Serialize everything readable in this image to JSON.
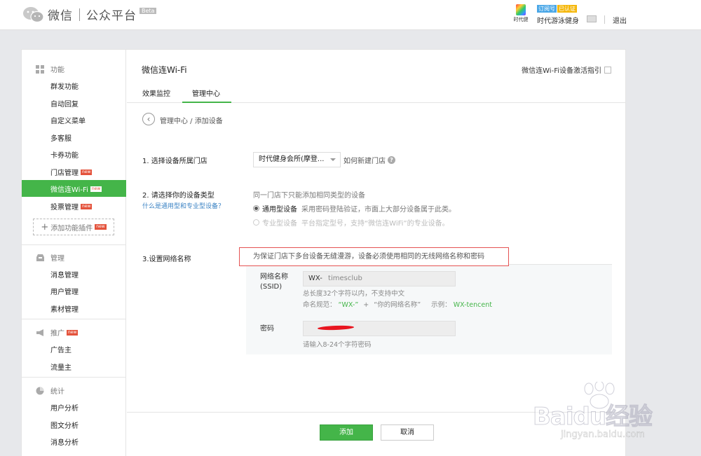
{
  "header": {
    "app_name": "微信",
    "platform": "公众平台",
    "beta": "Beta",
    "account_caption": "时代健",
    "badge_subscription": "订阅号",
    "badge_verified": "已认证",
    "account_name": "时代游泳健身",
    "logout": "退出"
  },
  "sidebar": {
    "sections": {
      "features": "功能",
      "management": "管理",
      "promotion": "推广",
      "statistics": "统计"
    },
    "new_badge": "new",
    "features_items": [
      "群发功能",
      "自动回复",
      "自定义菜单",
      "多客服",
      "卡券功能",
      "门店管理"
    ],
    "active_item": "微信连Wi-Fi",
    "vote_item": "投票管理",
    "add_plugin": "添加功能插件",
    "management_items": [
      "消息管理",
      "用户管理",
      "素材管理"
    ],
    "promotion_items": [
      "广告主",
      "流量主"
    ],
    "statistics_items": [
      "用户分析",
      "图文分析",
      "消息分析"
    ]
  },
  "main": {
    "title": "微信连Wi-Fi",
    "guide_link": "微信连Wi-Fi设备激活指引",
    "tabs": [
      "效果监控",
      "管理中心"
    ],
    "active_tab": "管理中心",
    "breadcrumb": "管理中心 / 添加设备",
    "step1": {
      "label": "1. 选择设备所属门店",
      "selected": "时代健身会所(摩登...",
      "howto": "如何新建门店"
    },
    "step2": {
      "label": "2. 请选择你的设备类型",
      "help_link": "什么是通用型和专业型设备？",
      "hint": "同一门店下只能添加相同类型的设备",
      "option1_name": "通用型设备",
      "option1_desc": "采用密码登陆验证，市面上大部分设备属于此类。",
      "option2_name": "专业型设备",
      "option2_desc": "平台指定型号，支持“微信连WiFi”的专业设备。"
    },
    "step3": {
      "label": "3.设置网络名称",
      "warning": "为保证门店下多台设备无缝漫游，设备必须使用相同的无线网络名称和密码",
      "ssid_label_1": "网络名称",
      "ssid_label_2": "(SSID)",
      "ssid_prefix": "WX-",
      "ssid_value": "timesclub",
      "ssid_note1": "总长度32个字符以内，不支持中文",
      "ssid_rule_prefix": "命名规范：",
      "ssid_rule_wx": "“WX-”",
      "ssid_rule_plus": "+",
      "ssid_rule_name": "“你的网络名称”",
      "ssid_rule_example_label": "示例：",
      "ssid_rule_example": "WX-tencent",
      "password_label": "密码",
      "password_note": "请输入8-24个字符密码"
    },
    "buttons": {
      "ok": "添加",
      "cancel": "取消"
    }
  },
  "watermark": {
    "text": "Baidu经验",
    "url": "jingyan.baidu.com"
  },
  "colors": {
    "accent": "#44b549",
    "link": "#3b83c4",
    "warning_border": "#e55353"
  }
}
